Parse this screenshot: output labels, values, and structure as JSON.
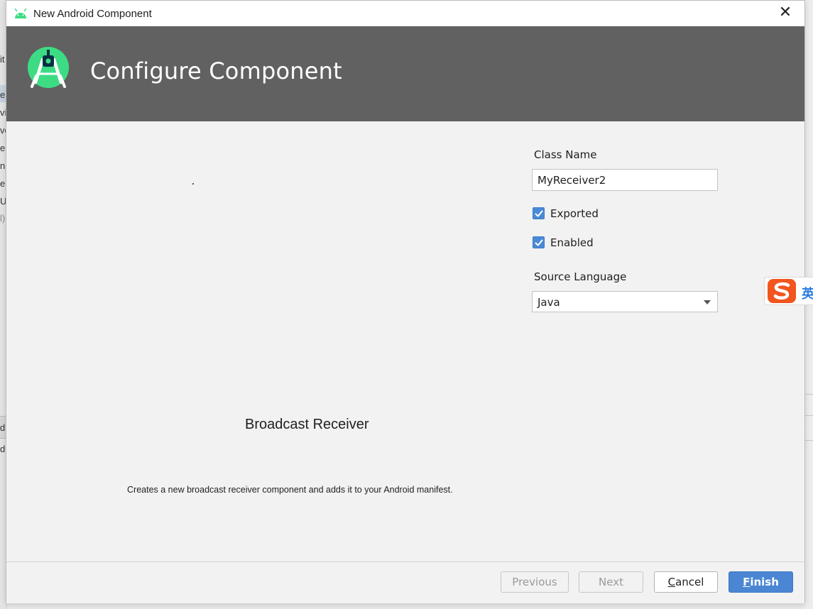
{
  "window": {
    "title": "New Android Component",
    "close_icon": "close-icon"
  },
  "header": {
    "heading": "Configure Component",
    "logo": "android-studio-logo"
  },
  "component": {
    "name": "Broadcast Receiver",
    "description": "Creates a new broadcast receiver component and adds it to your Android manifest."
  },
  "form": {
    "class_name_label": "Class Name",
    "class_name_value": "MyReceiver2",
    "exported_label": "Exported",
    "exported_checked": true,
    "enabled_label": "Enabled",
    "enabled_checked": true,
    "source_language_label": "Source Language",
    "source_language_value": "Java"
  },
  "buttons": {
    "previous": "Previous",
    "next": "Next",
    "cancel_first": "C",
    "cancel_rest": "ancel",
    "finish_first": "F",
    "finish_rest": "inish"
  },
  "background": {
    "left_fragments": [
      "it",
      "e",
      "vi",
      "ve",
      "e",
      "n",
      "e",
      "U",
      "l)",
      "d",
      "d"
    ],
    "ime_char": "英"
  },
  "colors": {
    "header_bg": "#616161",
    "accent": "#4a86d3",
    "android_green": "#3ddc84"
  }
}
